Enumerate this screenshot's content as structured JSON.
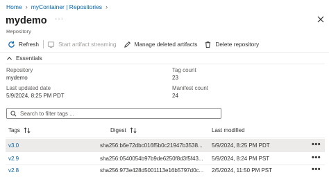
{
  "breadcrumb": {
    "items": [
      "Home",
      "myContainer | Repositories"
    ]
  },
  "header": {
    "title": "mydemo",
    "more": "···",
    "subtitle": "Repository"
  },
  "toolbar": {
    "refresh": "Refresh",
    "start_streaming": "Start artifact streaming",
    "manage_deleted": "Manage deleted artifacts",
    "delete_repo": "Delete repository"
  },
  "essentials": {
    "heading": "Essentials",
    "repository_label": "Repository",
    "repository_value": "mydemo",
    "last_updated_label": "Last updated date",
    "last_updated_value": "5/9/2024, 8:25 PM PDT",
    "tag_count_label": "Tag count",
    "tag_count_value": "23",
    "manifest_count_label": "Manifest count",
    "manifest_count_value": "24"
  },
  "search": {
    "placeholder": "Search to filter tags ..."
  },
  "table": {
    "columns": {
      "tags": "Tags",
      "digest": "Digest",
      "modified": "Last modified"
    },
    "rows": [
      {
        "tag": "v3.0",
        "digest": "sha256:b6e72dbc016f5b0c21947b3538...",
        "modified": "5/9/2024, 8:25 PM PDT",
        "more": "•••",
        "selected": true
      },
      {
        "tag": "v2.9",
        "digest": "sha256:0540054b97b9de6250f8d3f5f43...",
        "modified": "5/9/2024, 8:24 PM PST",
        "more": "•••",
        "selected": false
      },
      {
        "tag": "v2.8",
        "digest": "sha256:973e428d5001113e16b5797d0c...",
        "modified": "2/5/2024, 11:50 PM PST",
        "more": "•••",
        "selected": false
      }
    ]
  },
  "colors": {
    "link": "#0062ad",
    "text": "#323130",
    "muted": "#605e5c",
    "disabled": "#a19f9d",
    "selected_row": "#edebe9"
  }
}
